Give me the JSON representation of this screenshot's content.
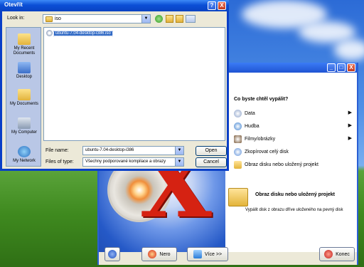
{
  "dialog": {
    "title": "Otevřít",
    "look_in_label": "Look in:",
    "look_in_value": "iso",
    "places": [
      {
        "label": "My Recent Documents",
        "icon": "recent-documents-icon"
      },
      {
        "label": "Desktop",
        "icon": "desktop-icon"
      },
      {
        "label": "My Documents",
        "icon": "my-documents-icon"
      },
      {
        "label": "My Computer",
        "icon": "my-computer-icon"
      },
      {
        "label": "My Network",
        "icon": "my-network-icon"
      }
    ],
    "files": [
      {
        "name": "ubuntu-7.04-desktop-i386.iso",
        "icon": "iso-file-icon",
        "selected": true
      }
    ],
    "file_name_label": "File name:",
    "file_name_value": "ubuntu-7.04-desktop-i386",
    "file_type_label": "Files of type:",
    "file_type_value": "Všechny podporované kompilace a obrazy",
    "open_label": "Open",
    "cancel_label": "Cancel",
    "help_label": "?",
    "close_label": "X"
  },
  "nero": {
    "panel_title": "Co byste chtěl vypálit?",
    "menu_items": [
      {
        "label": "Data",
        "icon": "data-icon",
        "has_submenu": true
      },
      {
        "label": "Hudba",
        "icon": "music-icon",
        "has_submenu": true
      },
      {
        "label": "Filmy/obrázky",
        "icon": "film-icon",
        "has_submenu": true
      },
      {
        "label": "Zkopírovat celý disk",
        "icon": "copy-disc-icon",
        "has_submenu": false
      },
      {
        "label": "Obraz disku nebo uložený projekt",
        "icon": "disc-image-icon",
        "has_submenu": false
      }
    ],
    "section_title": "Obraz disku nebo uložený projekt",
    "section_desc": "Vypálit disk z obrazu dříve uloženého na pevný disk",
    "buttons": {
      "nero_label": "Nero",
      "more_label": "Více >>",
      "exit_label": "Konec"
    },
    "window_buttons": {
      "minimize": "_",
      "maximize": "□",
      "close": "X"
    }
  }
}
